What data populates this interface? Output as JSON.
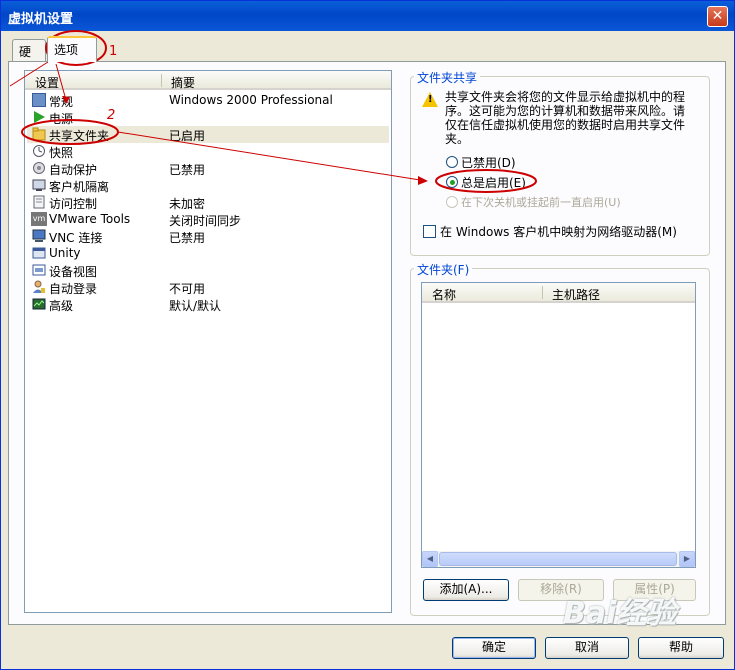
{
  "window": {
    "title": "虚拟机设置",
    "close_glyph": "✕"
  },
  "tabs": [
    {
      "label": "硬件"
    },
    {
      "label": "选项"
    }
  ],
  "settings_list": {
    "headers": {
      "setting": "设置",
      "summary": "摘要"
    },
    "rows": [
      {
        "name": "常规",
        "summary": "Windows 2000 Professional",
        "icon": "general-icon"
      },
      {
        "name": "电源",
        "summary": "",
        "icon": "power-icon"
      },
      {
        "name": "共享文件夹",
        "summary": "已启用",
        "icon": "shared-folder-icon",
        "selected": true
      },
      {
        "name": "快照",
        "summary": "",
        "icon": "snapshot-icon"
      },
      {
        "name": "自动保护",
        "summary": "已禁用",
        "icon": "autoprotect-icon"
      },
      {
        "name": "客户机隔离",
        "summary": "",
        "icon": "isolation-icon"
      },
      {
        "name": "访问控制",
        "summary": "未加密",
        "icon": "access-control-icon"
      },
      {
        "name": "VMware Tools",
        "summary": "关闭时间同步",
        "icon": "vmware-tools-icon"
      },
      {
        "name": "VNC 连接",
        "summary": "已禁用",
        "icon": "vnc-icon"
      },
      {
        "name": "Unity",
        "summary": "",
        "icon": "unity-icon"
      },
      {
        "name": "设备视图",
        "summary": "",
        "icon": "device-view-icon"
      },
      {
        "name": "自动登录",
        "summary": "不可用",
        "icon": "autologin-icon"
      },
      {
        "name": "高级",
        "summary": "默认/默认",
        "icon": "advanced-icon"
      }
    ]
  },
  "folder_sharing": {
    "title": "文件夹共享",
    "warning": "共享文件夹会将您的文件显示给虚拟机中的程序。这可能为您的计算机和数据带来风险。请仅在信任虚拟机使用您的数据时启用共享文件夹。",
    "options": [
      {
        "label": "已禁用(D)",
        "checked": false,
        "disabled": false
      },
      {
        "label": "总是启用(E)",
        "checked": true,
        "disabled": false
      },
      {
        "label": "在下次关机或挂起前一直启用(U)",
        "checked": false,
        "disabled": true
      }
    ],
    "map_drive_label": "在 Windows 客户机中映射为网络驱动器(M)",
    "map_drive_checked": false
  },
  "folders": {
    "title": "文件夹(F)",
    "headers": {
      "name": "名称",
      "host_path": "主机路径"
    },
    "buttons": {
      "add": "添加(A)...",
      "remove": "移除(R)",
      "properties": "属性(P)"
    }
  },
  "footer": {
    "ok": "确定",
    "cancel": "取消",
    "help": "帮助"
  },
  "annotations": {
    "step1": "1",
    "step2": "2",
    "color": "#cc0000"
  },
  "watermark": "Bai经验"
}
